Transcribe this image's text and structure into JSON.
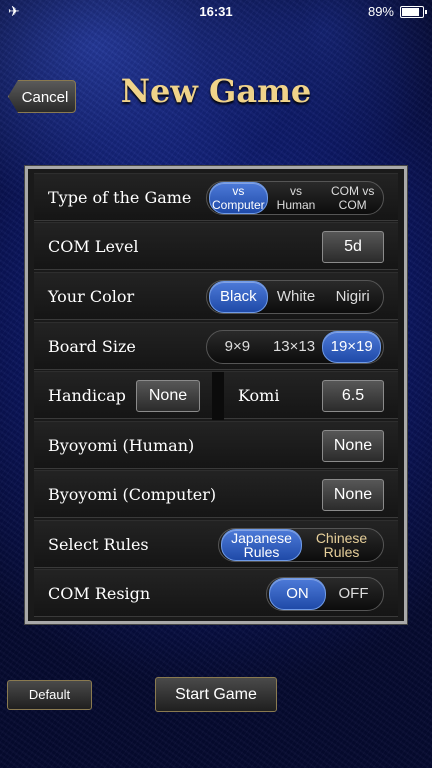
{
  "status_bar": {
    "time": "16:31",
    "battery": "89%"
  },
  "header": {
    "cancel_label": "Cancel",
    "title": "New Game"
  },
  "settings": {
    "game_type": {
      "label": "Type of the Game",
      "options": [
        "vs Computer",
        "vs Human",
        "COM vs COM"
      ],
      "selected": "vs Computer"
    },
    "com_level": {
      "label": "COM Level",
      "value": "5d"
    },
    "your_color": {
      "label": "Your Color",
      "options": [
        "Black",
        "White",
        "Nigiri"
      ],
      "selected": "Black"
    },
    "board_size": {
      "label": "Board Size",
      "options": [
        "9×9",
        "13×13",
        "19×19"
      ],
      "selected": "19×19"
    },
    "handicap": {
      "label": "Handicap",
      "value": "None"
    },
    "komi": {
      "label": "Komi",
      "value": "6.5"
    },
    "byoyomi_human": {
      "label": "Byoyomi (Human)",
      "value": "None"
    },
    "byoyomi_computer": {
      "label": "Byoyomi (Computer)",
      "value": "None"
    },
    "rules": {
      "label": "Select Rules",
      "options": [
        "Japanese Rules",
        "Chinese Rules"
      ],
      "selected": "Japanese Rules"
    },
    "com_resign": {
      "label": "COM Resign",
      "options": [
        "ON",
        "OFF"
      ],
      "selected": "ON"
    }
  },
  "footer": {
    "default_label": "Default",
    "start_label": "Start Game"
  },
  "colors": {
    "accent": "#2e5fc4",
    "title_gold": "#f0d38a"
  }
}
